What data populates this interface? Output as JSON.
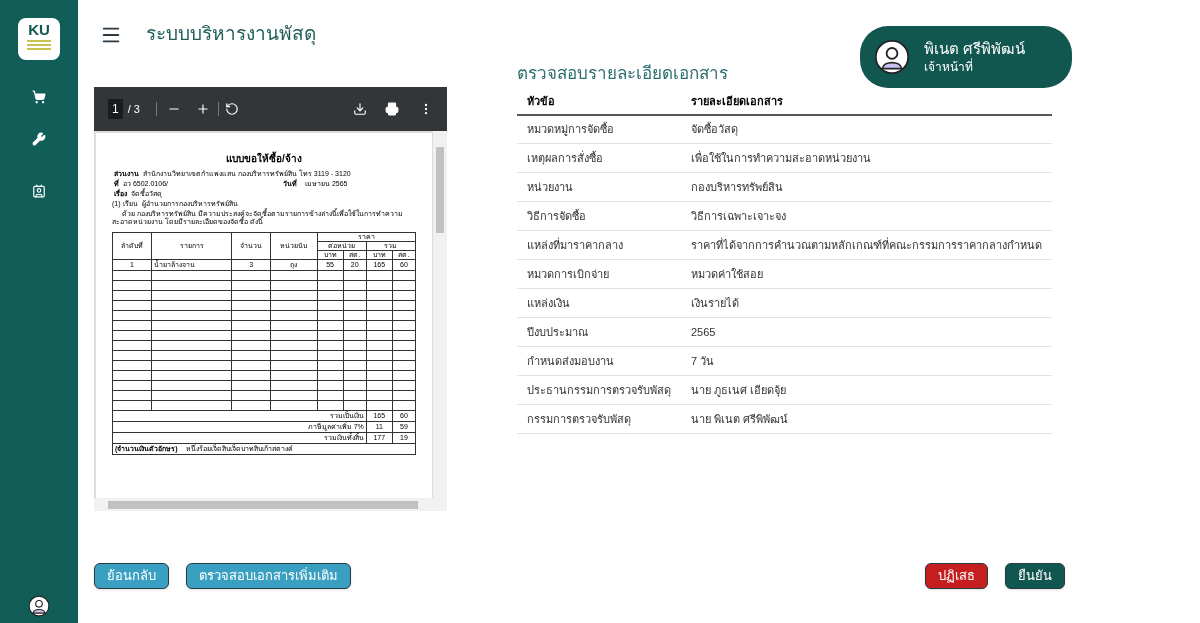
{
  "sidebar": {
    "logo": "KU"
  },
  "header": {
    "title": "ระบบบริหารงานพัสดุ"
  },
  "user": {
    "name": "พิเนต ศรีพิพัฒน์",
    "role": "เจ้าหน้าที่"
  },
  "pdf_viewer": {
    "page": "1",
    "page_count": "/ 3",
    "document": {
      "title": "แบบขอให้ซื้อ/จ้าง",
      "fields": [
        {
          "label": "ส่วนงาน",
          "value": "สำนักงานวิทยาเขตกำแพงแสน กองบริหารทรัพย์สิน โทร 3119 - 3120"
        },
        {
          "label": "ที่",
          "value": "อว 6502.0106/",
          "label_2": "วันที่",
          "value_2": "เมษายน 2565"
        },
        {
          "label": "เรื่อง",
          "value": "จัดซื้อวัสดุ"
        }
      ],
      "salutation": {
        "label": "(1) เรียน",
        "value": "ผู้อำนวยการกองบริหารทรัพย์สิน"
      },
      "body_1": "ด้วย กองบริหารทรัพย์สิน มีความประสงค์จะจัดซื้อตามรายการข้างล่างนี้เพื่อใช้ในการทำความ",
      "body_2": "สะอาดหน่วยงาน โดยมีรายละเอียดของจัดซื้อ ดังนี้",
      "table_head": {
        "no": "ลำดับที่",
        "item": "รายการ",
        "qty": "จำนวน",
        "unit": "หน่วยนับ",
        "price": "ราคา",
        "per_unit": "ต่อหน่วย",
        "total": "รวม",
        "baht": "บาท",
        "satang": "สต.",
        "baht_2": "บาท",
        "satang_2": "สต."
      },
      "items": [
        {
          "no": "1",
          "item": "น้ำยาล้างจาน",
          "qty": "3",
          "unit": "ถุง",
          "unit_baht": "55",
          "unit_satang": "20",
          "total_baht": "165",
          "total_satang": "60"
        }
      ],
      "totals": [
        {
          "label": "รวมเป็นเงิน",
          "baht": "165",
          "satang": "60"
        },
        {
          "label": "ภาษีมูลค่าเพิ่ม 7%",
          "baht": "11",
          "satang": "59"
        },
        {
          "label": "รวมเงินทั้งสิ้น",
          "baht": "177",
          "satang": "19"
        }
      ],
      "amount_words": {
        "label": "(จำนวนเงินตัวอักษร)",
        "value": "หนึ่งร้อยเจ็ดสิบเจ็ดบาทสิบเก้าสตางค์"
      }
    }
  },
  "details": {
    "title": "ตรวจสอบรายละเอียดเอกสาร",
    "columns": [
      "หัวข้อ",
      "รายละเอียดเอกสาร"
    ],
    "rows": [
      {
        "topic": "หมวดหมู่การจัดซื้อ",
        "detail": "จัดซื้อวัสดุ"
      },
      {
        "topic": "เหตุผลการสั่งซื้อ",
        "detail": "เพื่อใช้ในการทำความสะอาดหน่วยงาน"
      },
      {
        "topic": "หน่วยงาน",
        "detail": "กองบริหารทรัพย์สิน"
      },
      {
        "topic": "วิธีการจัดซื้อ",
        "detail": "วิธีการเฉพาะเจาะจง"
      },
      {
        "topic": "แหล่งที่มาราคากลาง",
        "detail": "ราคาที่ได้จากการคำนวณตามหลักเกณฑ์ที่คณะกรรมการราคากลางกำหนด"
      },
      {
        "topic": "หมวดการเบิกจ่าย",
        "detail": "หมวดค่าใช้สอย"
      },
      {
        "topic": "แหล่งเงิน",
        "detail": "เงินรายได้"
      },
      {
        "topic": "ปีงบประมาณ",
        "detail": "2565"
      },
      {
        "topic": "กำหนดส่งมอบงาน",
        "detail": "7 วัน"
      },
      {
        "topic": "ประธานกรรมการตรวจรับพัสดุ",
        "detail": "นาย ภูธเนศ เอียดจุ้ย"
      },
      {
        "topic": "กรรมการตรวจรับพัสดุ",
        "detail": "นาย พิเนต ศรีพิพัฒน์"
      }
    ]
  },
  "buttons": [
    {
      "label": "ย้อนกลับ",
      "kind": "info"
    },
    {
      "label": "ตรวจสอบเอกสารเพิ่มเติม",
      "kind": "info"
    },
    {
      "label": "ปฏิเสธ",
      "kind": "danger"
    },
    {
      "label": "ยืนยัน",
      "kind": "primary"
    }
  ]
}
